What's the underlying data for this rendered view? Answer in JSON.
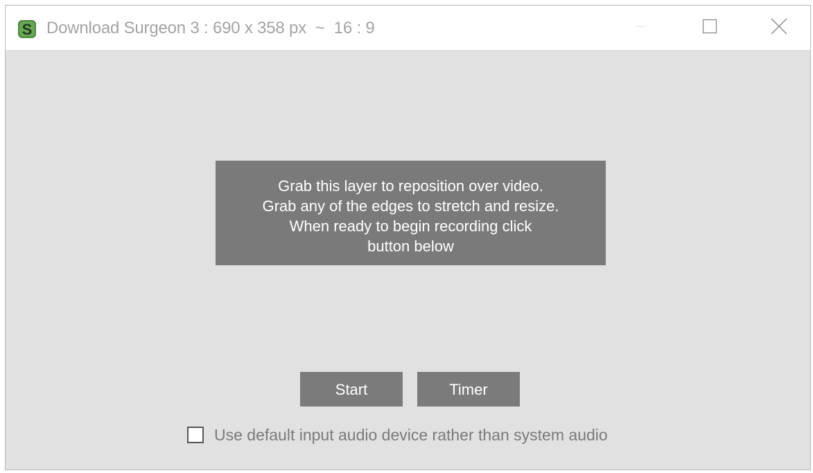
{
  "window": {
    "title": "Download Surgeon 3 : 690 x 358 px  ~  16 : 9",
    "app_icon": "surgeon-s-icon",
    "controls": [
      "minimize-icon",
      "maximize-icon",
      "close-icon"
    ]
  },
  "overlay": {
    "lines": [
      "Grab this layer to reposition over video.",
      "Grab any of the edges to stretch and resize.",
      "When ready to begin recording click",
      "button below"
    ]
  },
  "buttons": {
    "start_label": "Start",
    "timer_label": "Timer"
  },
  "audio_option": {
    "label": "Use default input audio device rather than system audio",
    "checked": false
  },
  "colors": {
    "window_bg": "#e1e1e1",
    "titlebar_bg": "#ffffff",
    "overlay_bg": "#7a7a7a",
    "button_bg": "#7b7b7b",
    "icon_green": "#4a8a3c"
  }
}
